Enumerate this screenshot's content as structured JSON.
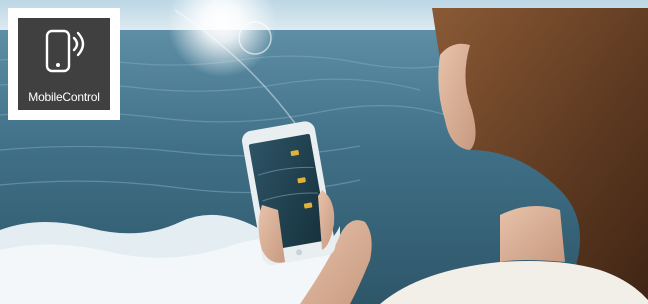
{
  "badge": {
    "label": "MobileControl",
    "icon": "smartphone-wireless-icon",
    "background_color": "#404040",
    "text_color": "#ffffff"
  },
  "photo": {
    "subject": "woman-holding-smartphone-by-sea",
    "colors": {
      "sea": "#3f6f86",
      "sky": "#cfe2ec",
      "foam": "#eaf2f5",
      "hair": "#6b4328",
      "screen": "#1f3c4a",
      "accent": "#e1b13c"
    }
  }
}
